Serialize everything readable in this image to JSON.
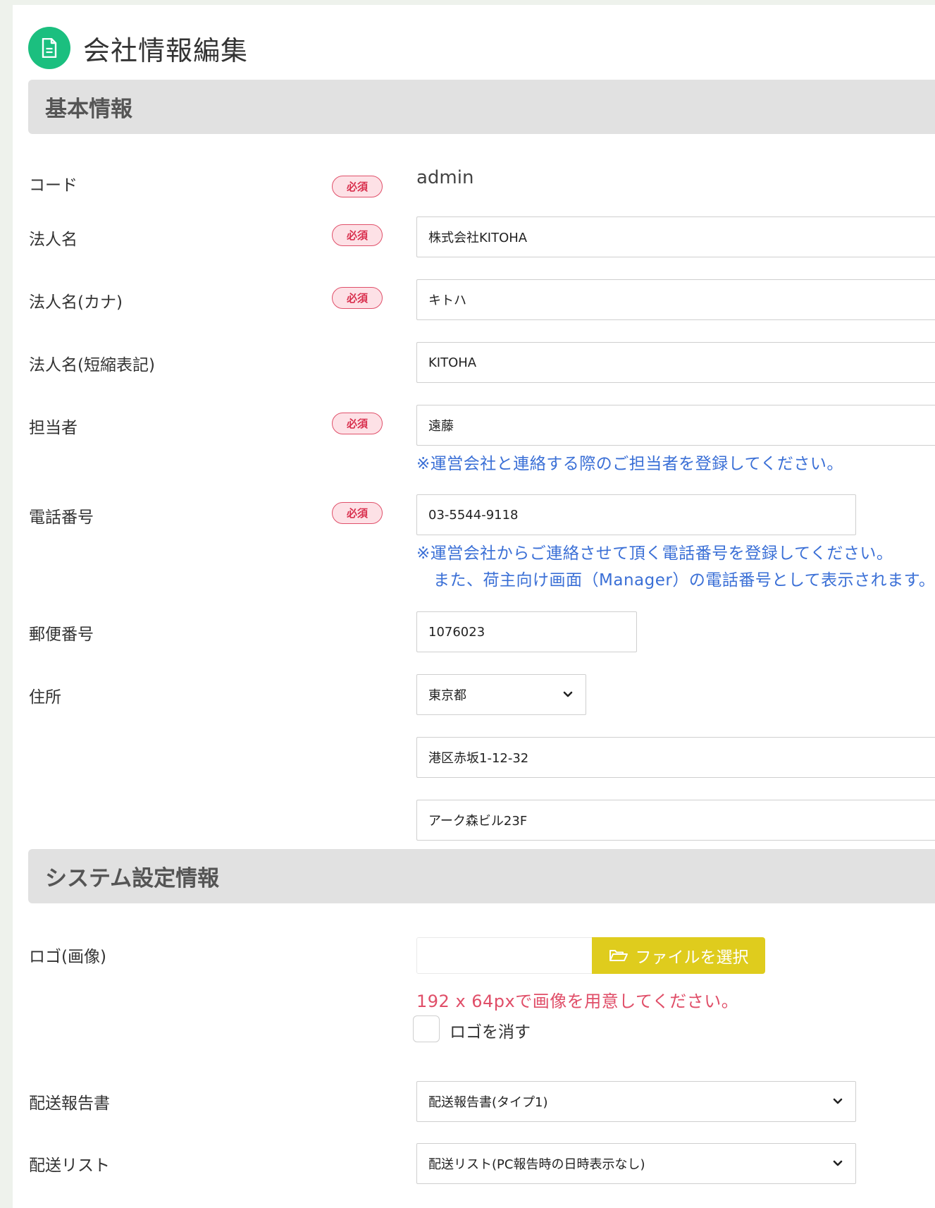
{
  "page": {
    "title": "会社情報編集",
    "icon": "document-icon"
  },
  "sections": {
    "basic": "基本情報",
    "system": "システム設定情報"
  },
  "required_badge": "必須",
  "fields": {
    "code": {
      "label": "コード",
      "value": "admin"
    },
    "corp_name": {
      "label": "法人名",
      "value": "株式会社KITOHA"
    },
    "corp_kana": {
      "label": "法人名(カナ)",
      "value": "キトハ"
    },
    "corp_short": {
      "label": "法人名(短縮表記)",
      "value": "KITOHA"
    },
    "contact": {
      "label": "担当者",
      "value": "遠藤",
      "note": "※運営会社と連絡する際のご担当者を登録してください。"
    },
    "phone": {
      "label": "電話番号",
      "value": "03-5544-9118",
      "note1": "※運営会社からご連絡させて頂く電話番号を登録してください。",
      "note2": "また、荷主向け画面（Manager）の電話番号として表示されます。"
    },
    "postal": {
      "label": "郵便番号",
      "value": "1076023"
    },
    "address": {
      "label": "住所",
      "prefecture": "東京都",
      "line1": "港区赤坂1-12-32",
      "line2": "アーク森ビル23F"
    },
    "logo": {
      "label": "ロゴ(画像)",
      "button": "ファイルを選択",
      "note": "192 x 64pxで画像を用意してください。",
      "remove_label": "ロゴを消す"
    },
    "delivery_report": {
      "label": "配送報告書",
      "value": "配送報告書(タイプ1)"
    },
    "delivery_list": {
      "label": "配送リスト",
      "value": "配送リスト(PC報告時の日時表示なし)"
    }
  },
  "colors": {
    "accent": "#1bbf7f",
    "required": "#d9304e",
    "note": "#3a6fd6",
    "warn": "#e04e68",
    "file_button": "#dfcc1d"
  }
}
